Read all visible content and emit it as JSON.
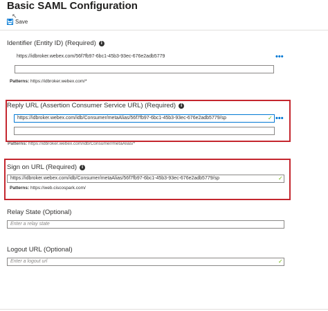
{
  "header": {
    "title": "Basic SAML Configuration",
    "save_label": "Save"
  },
  "identifier": {
    "label": "Identifier (Entity ID) (Required)",
    "value": "https://idbroker.webex.com/56f7fb97-6bc1-45b3-93ec-676e2adb5779",
    "more": "•••",
    "empty_value": "",
    "patterns_label": "Patterns:",
    "patterns_value": "https://idbroker.webex.com/*"
  },
  "reply_url": {
    "label": "Reply URL (Assertion Consumer Service URL) (Required)",
    "value": "https://idbroker.webex.com/idb/Consumer/metaAlias/56f7fb97-6bc1-45b3-93ec-676e2adb5779/sp",
    "more": "•••",
    "empty_value": "",
    "patterns_label": "Patterns:",
    "patterns_value": "https://idbroker.webex.com/idb/Consumer/metaAlias/*"
  },
  "sign_on_url": {
    "label": "Sign on URL (Required)",
    "value": "https://idbroker.webex.com/idb/Consumer/metaAlias/56f7fb97-6bc1-45b3-93ec-676e2adb5779/sp",
    "patterns_label": "Patterns:",
    "patterns_value": "https://web.ciscospark.com/"
  },
  "relay_state": {
    "label": "Relay State (Optional)",
    "placeholder": "Enter a relay state"
  },
  "logout_url": {
    "label": "Logout URL (Optional)",
    "placeholder": "Enter a logout url"
  },
  "icons": {
    "check": "✓",
    "info": "i"
  },
  "colors": {
    "highlight_border": "#c4262e",
    "accent": "#0078d4",
    "valid": "#6bb700"
  }
}
